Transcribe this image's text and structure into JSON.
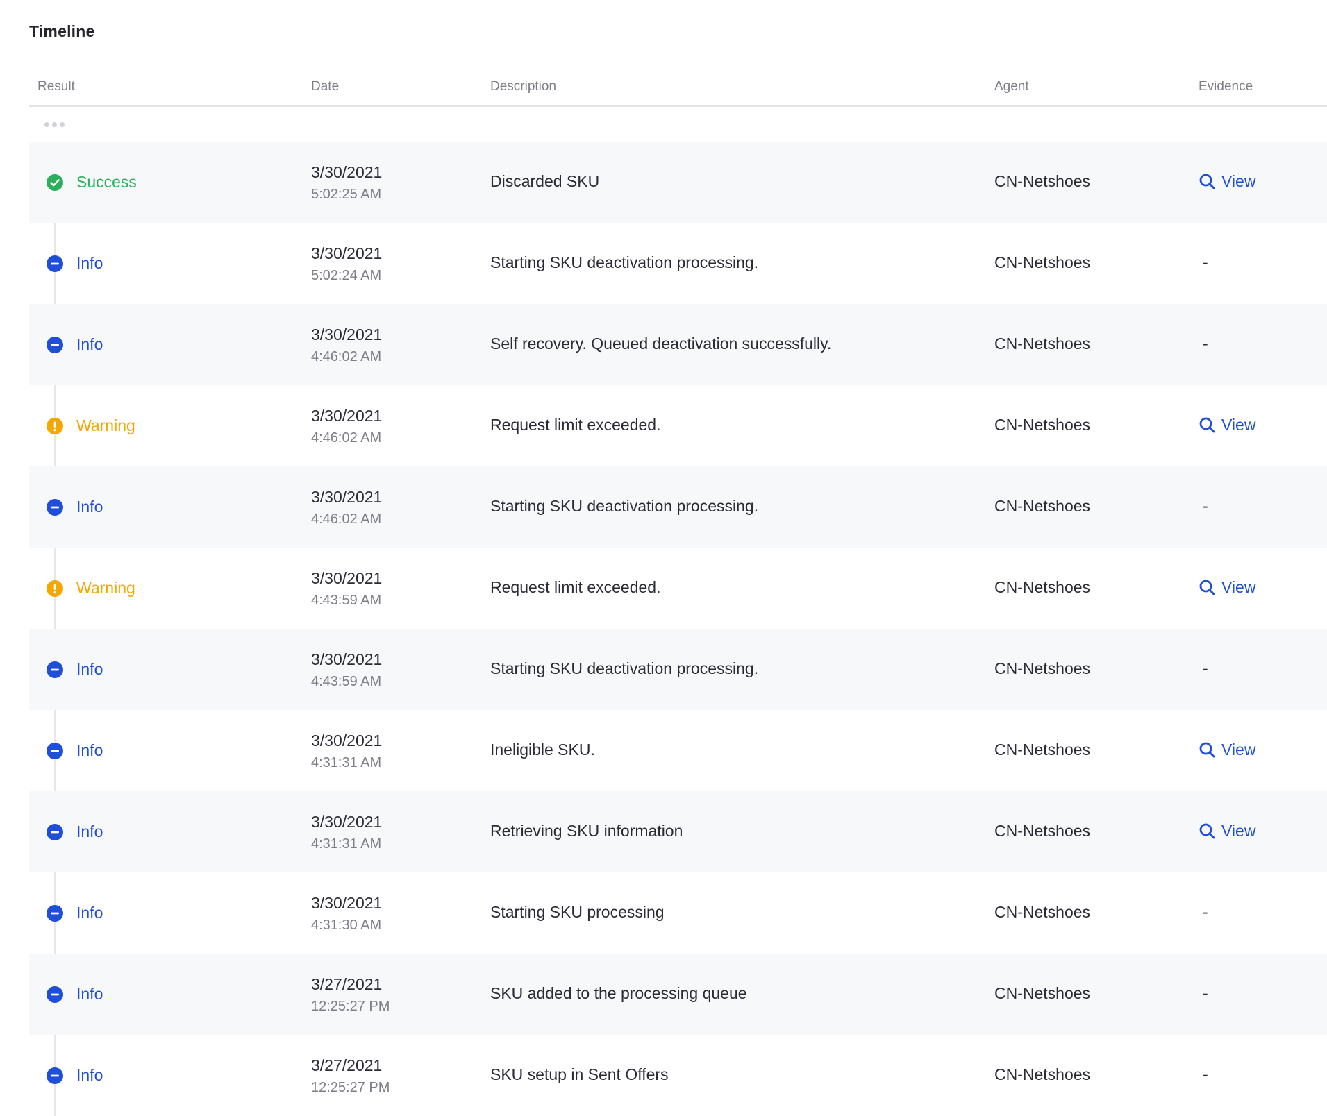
{
  "page": {
    "title": "Timeline"
  },
  "columns": {
    "result": "Result",
    "date": "Date",
    "description": "Description",
    "agent": "Agent",
    "evidence": "Evidence"
  },
  "colors": {
    "success": "#2ab05a",
    "info": "#1f4fd9",
    "warning": "#f5a700",
    "link": "#1f4fd9"
  },
  "rows": [
    {
      "status": "success",
      "result": "Success",
      "date": "3/30/2021",
      "time": "5:02:25 AM",
      "description": "Discarded SKU",
      "agent": "CN-Netshoes",
      "evidence": "View",
      "has_evidence": true
    },
    {
      "status": "info",
      "result": "Info",
      "date": "3/30/2021",
      "time": "5:02:24 AM",
      "description": "Starting SKU deactivation processing.",
      "agent": "CN-Netshoes",
      "evidence": "-",
      "has_evidence": false
    },
    {
      "status": "info",
      "result": "Info",
      "date": "3/30/2021",
      "time": "4:46:02 AM",
      "description": "Self recovery. Queued deactivation successfully.",
      "agent": "CN-Netshoes",
      "evidence": "-",
      "has_evidence": false
    },
    {
      "status": "warning",
      "result": "Warning",
      "date": "3/30/2021",
      "time": "4:46:02 AM",
      "description": "Request limit exceeded.",
      "agent": "CN-Netshoes",
      "evidence": "View",
      "has_evidence": true
    },
    {
      "status": "info",
      "result": "Info",
      "date": "3/30/2021",
      "time": "4:46:02 AM",
      "description": "Starting SKU deactivation processing.",
      "agent": "CN-Netshoes",
      "evidence": "-",
      "has_evidence": false
    },
    {
      "status": "warning",
      "result": "Warning",
      "date": "3/30/2021",
      "time": "4:43:59 AM",
      "description": "Request limit exceeded.",
      "agent": "CN-Netshoes",
      "evidence": "View",
      "has_evidence": true
    },
    {
      "status": "info",
      "result": "Info",
      "date": "3/30/2021",
      "time": "4:43:59 AM",
      "description": "Starting SKU deactivation processing.",
      "agent": "CN-Netshoes",
      "evidence": "-",
      "has_evidence": false
    },
    {
      "status": "info",
      "result": "Info",
      "date": "3/30/2021",
      "time": "4:31:31 AM",
      "description": "Ineligible SKU.",
      "agent": "CN-Netshoes",
      "evidence": "View",
      "has_evidence": true
    },
    {
      "status": "info",
      "result": "Info",
      "date": "3/30/2021",
      "time": "4:31:31 AM",
      "description": "Retrieving SKU information",
      "agent": "CN-Netshoes",
      "evidence": "View",
      "has_evidence": true
    },
    {
      "status": "info",
      "result": "Info",
      "date": "3/30/2021",
      "time": "4:31:30 AM",
      "description": "Starting SKU processing",
      "agent": "CN-Netshoes",
      "evidence": "-",
      "has_evidence": false
    },
    {
      "status": "info",
      "result": "Info",
      "date": "3/27/2021",
      "time": "12:25:27 PM",
      "description": "SKU added to the processing queue",
      "agent": "CN-Netshoes",
      "evidence": "-",
      "has_evidence": false
    },
    {
      "status": "info",
      "result": "Info",
      "date": "3/27/2021",
      "time": "12:25:27 PM",
      "description": "SKU setup in Sent Offers",
      "agent": "CN-Netshoes",
      "evidence": "-",
      "has_evidence": false
    }
  ]
}
